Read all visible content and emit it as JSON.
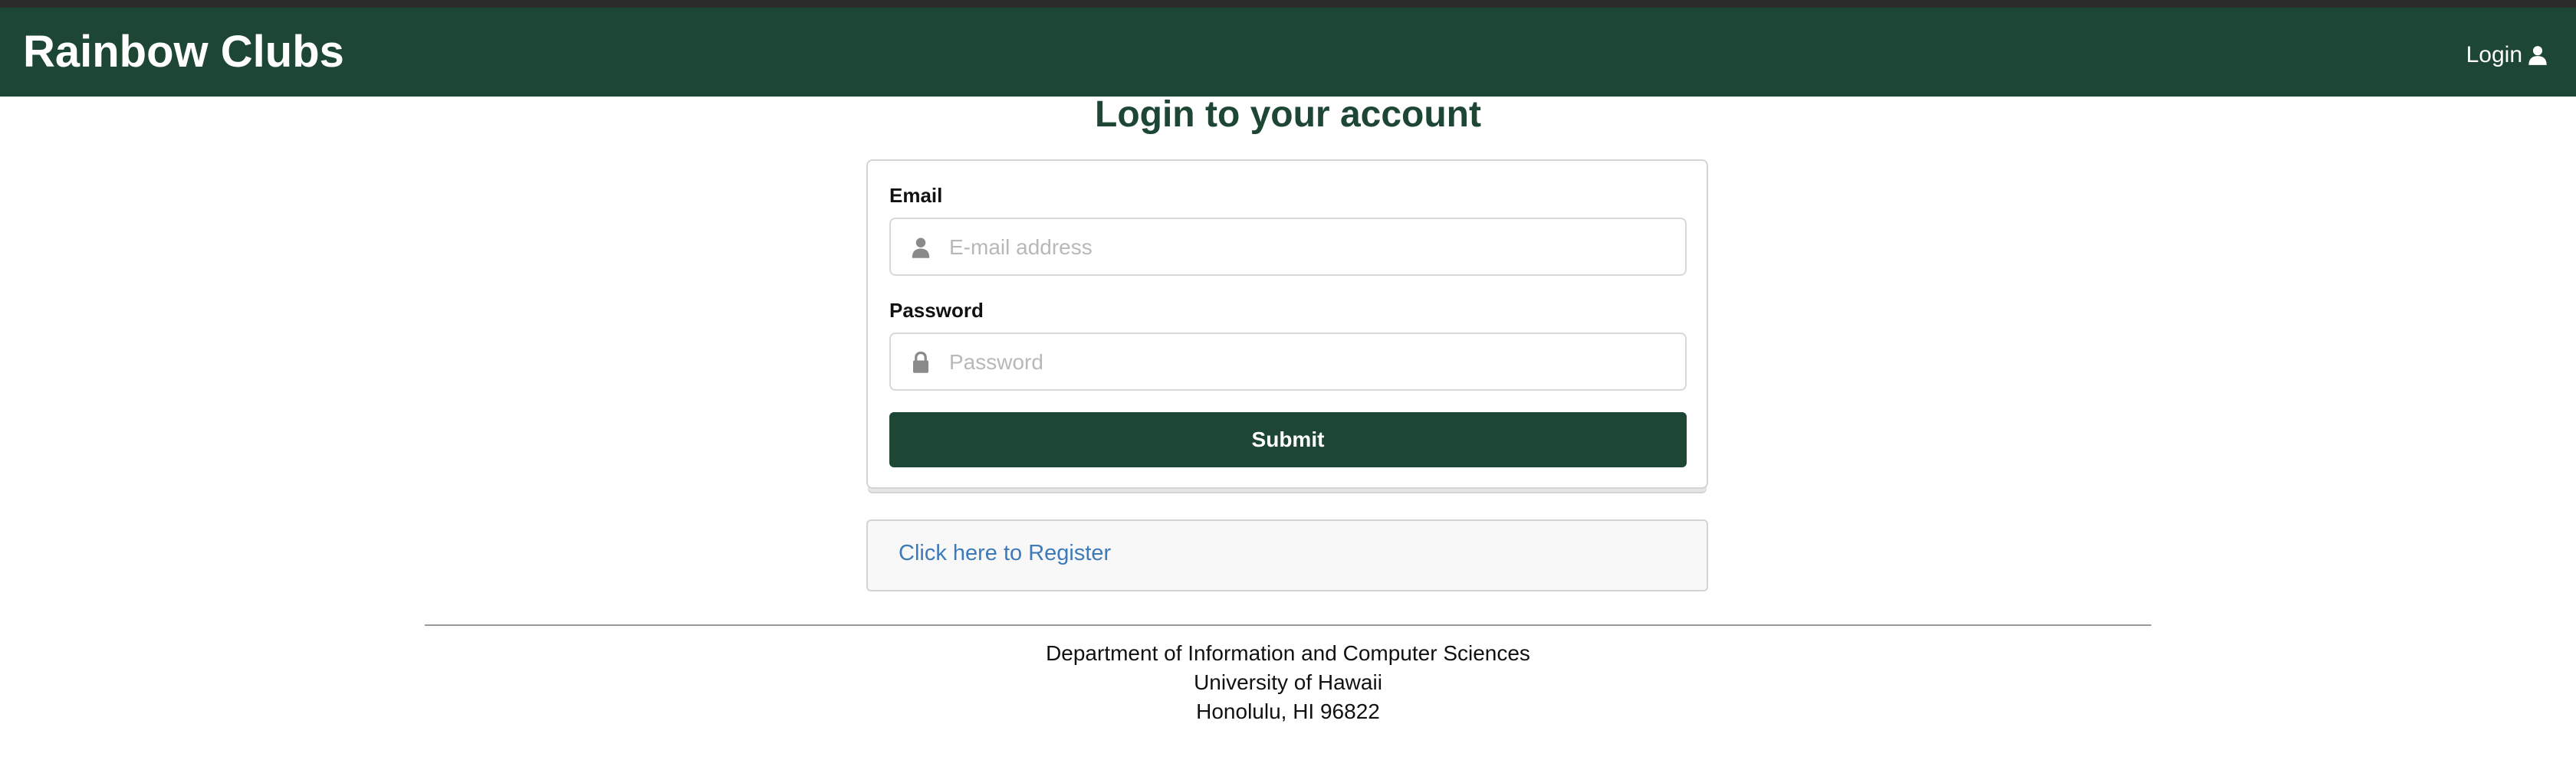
{
  "navbar": {
    "brand": "Rainbow Clubs",
    "login_label": "Login",
    "login_icon": "user-icon",
    "color": "#1e4634"
  },
  "page": {
    "title": "Login to your account"
  },
  "form": {
    "email_label": "Email",
    "email_placeholder": "E-mail address",
    "email_value": "",
    "email_icon": "user-icon",
    "password_label": "Password",
    "password_placeholder": "Password",
    "password_value": "",
    "password_icon": "lock-icon",
    "submit_label": "Submit"
  },
  "register": {
    "link_label": "Click here to Register",
    "link_color": "#3d7ab8"
  },
  "footer": {
    "line1": "Department of Information and Computer Sciences",
    "line2": "University of Hawaii",
    "line3": "Honolulu, HI 96822"
  }
}
